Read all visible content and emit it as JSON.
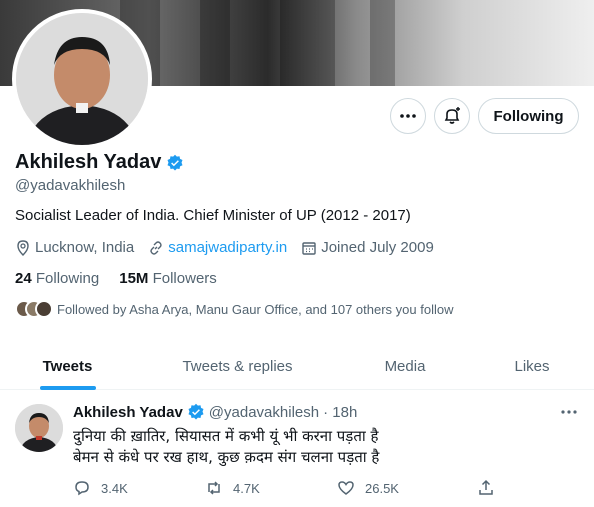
{
  "profile": {
    "name": "Akhilesh Yadav",
    "handle": "@yadavakhilesh",
    "bio": "Socialist Leader of India. Chief Minister of UP (2012 - 2017)",
    "location": "Lucknow, India",
    "website": "samajwadiparty.in",
    "joined": "Joined July 2009",
    "following_count": "24",
    "following_label": "Following",
    "followers_count": "15M",
    "followers_label": "Followers",
    "followed_by": "Followed by Asha Arya, Manu Gaur Office, and 107 others you follow"
  },
  "buttons": {
    "follow_label": "Following",
    "more_icon": "more-icon",
    "notify_icon": "bell-plus-icon"
  },
  "tabs": [
    {
      "label": "Tweets",
      "active": true
    },
    {
      "label": "Tweets & replies",
      "active": false
    },
    {
      "label": "Media",
      "active": false
    },
    {
      "label": "Likes",
      "active": false
    }
  ],
  "tweet": {
    "name": "Akhilesh Yadav",
    "handle": "@yadavakhilesh",
    "time": "· 18h",
    "line1": "दुनिया की ख़ातिर, सियासत में कभी यूं भी करना पड़ता है",
    "line2": "बेमन से कंधे पर रख हाथ, कुछ क़दम संग चलना पड़ता है",
    "replies": "3.4K",
    "retweets": "4.7K",
    "likes": "26.5K"
  },
  "colors": {
    "accent": "#1d9bf0",
    "text": "#0f1419",
    "secondary": "#536471",
    "border": "#cfd9de"
  }
}
